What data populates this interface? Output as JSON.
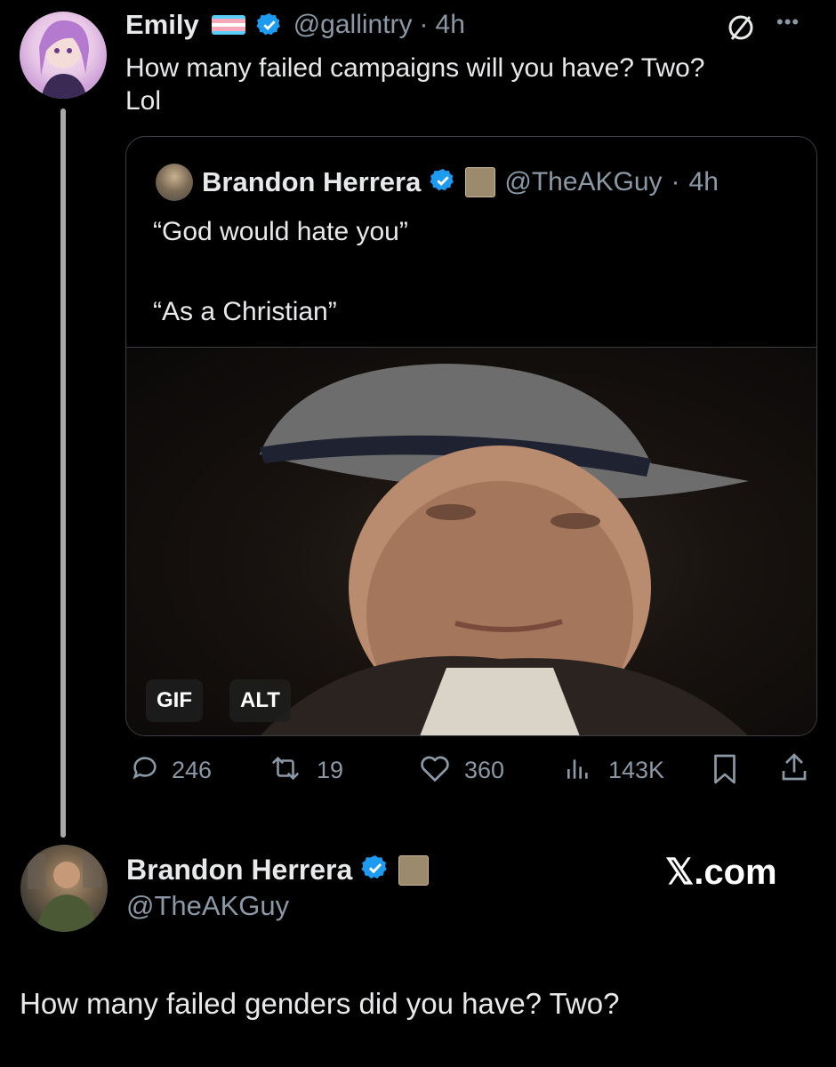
{
  "tweet": {
    "author_name": "Emily",
    "handle": "@gallintry",
    "separator": "·",
    "time": "4h",
    "text_line1": "How many failed campaigns will you have? Two?",
    "text_line2": "Lol",
    "more_label": "•••"
  },
  "quote": {
    "author_name": "Brandon Herrera",
    "handle": "@TheAKGuy",
    "separator": "·",
    "time": "4h",
    "line1": "“God would hate you”",
    "line2": "“As a Christian”",
    "gif_badge": "GIF",
    "alt_badge": "ALT"
  },
  "actions": {
    "replies": "246",
    "reposts": "19",
    "likes": "360",
    "views": "143K"
  },
  "reply_profile": {
    "name": "Brandon Herrera",
    "handle": "@TheAKGuy",
    "watermark": "𝕏.com"
  },
  "reply_text": "How many failed genders did you have? Two?",
  "colors": {
    "background": "#000000",
    "text": "#e7e9ea",
    "muted": "#8b98a5",
    "verified": "#1d9bf0"
  },
  "icons": [
    "verified-badge-icon",
    "trans-flag-icon",
    "not-allowed-icon",
    "more-icon",
    "reply-icon",
    "repost-icon",
    "like-icon",
    "views-icon",
    "bookmark-icon",
    "share-icon"
  ]
}
